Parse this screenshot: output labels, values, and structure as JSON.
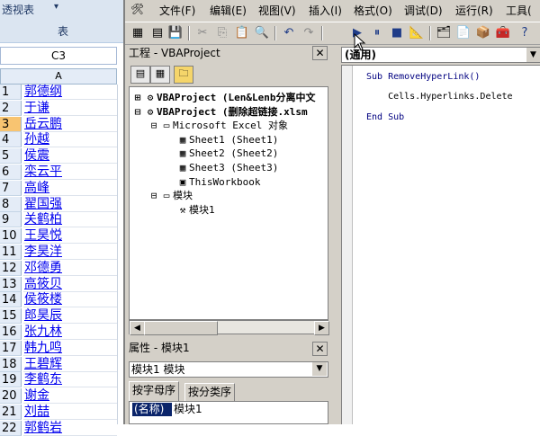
{
  "excel": {
    "ribbon_button": "透视表",
    "ribbon_button_arrow": "▾",
    "ribbon_group": "表",
    "name_box": "C3",
    "column_a": "A",
    "rows": [
      {
        "num": "1",
        "name": "郭德纲"
      },
      {
        "num": "2",
        "name": "于谦"
      },
      {
        "num": "3",
        "name": "岳云鹏"
      },
      {
        "num": "4",
        "name": "孙越"
      },
      {
        "num": "5",
        "name": "侯震"
      },
      {
        "num": "6",
        "name": "栾云平"
      },
      {
        "num": "7",
        "name": "高峰"
      },
      {
        "num": "8",
        "name": "翟国强"
      },
      {
        "num": "9",
        "name": "关鹤柏"
      },
      {
        "num": "10",
        "name": "王昊悦"
      },
      {
        "num": "11",
        "name": "李昊洋"
      },
      {
        "num": "12",
        "name": "邓德勇"
      },
      {
        "num": "13",
        "name": "高筱贝"
      },
      {
        "num": "14",
        "name": "侯筱楼"
      },
      {
        "num": "15",
        "name": "郎昊辰"
      },
      {
        "num": "16",
        "name": "张九林"
      },
      {
        "num": "17",
        "name": "韩九鸣"
      },
      {
        "num": "18",
        "name": "王碧辉"
      },
      {
        "num": "19",
        "name": "李鹤东"
      },
      {
        "num": "20",
        "name": "谢金"
      },
      {
        "num": "21",
        "name": "刘喆"
      },
      {
        "num": "22",
        "name": "郭鹤岩"
      }
    ],
    "selected_row": "3"
  },
  "vbe": {
    "menu": [
      "文件(F)",
      "编辑(E)",
      "视图(V)",
      "插入(I)",
      "格式(O)",
      "调试(D)",
      "运行(R)",
      "工具("
    ],
    "project_panel_title": "工程 - VBAProject",
    "close_symbol": "✕",
    "tree": [
      {
        "text": "VBAProject (Len&Lenb分离中文",
        "indent": 0,
        "toggle": "⊞",
        "icon": "⚙",
        "bold": true
      },
      {
        "text": "VBAProject (删除超链接.xlsm",
        "indent": 0,
        "toggle": "⊟",
        "icon": "⚙",
        "bold": true
      },
      {
        "text": "Microsoft Excel 对象",
        "indent": 1,
        "toggle": "⊟",
        "icon": "▭",
        "bold": false
      },
      {
        "text": "Sheet1 (Sheet1)",
        "indent": 2,
        "toggle": "",
        "icon": "▦",
        "bold": false
      },
      {
        "text": "Sheet2 (Sheet2)",
        "indent": 2,
        "toggle": "",
        "icon": "▦",
        "bold": false
      },
      {
        "text": "Sheet3 (Sheet3)",
        "indent": 2,
        "toggle": "",
        "icon": "▦",
        "bold": false
      },
      {
        "text": "ThisWorkbook",
        "indent": 2,
        "toggle": "",
        "icon": "▣",
        "bold": false
      },
      {
        "text": "模块",
        "indent": 1,
        "toggle": "⊟",
        "icon": "▭",
        "bold": false
      },
      {
        "text": "模块1",
        "indent": 2,
        "toggle": "",
        "icon": "⚒",
        "bold": false
      }
    ],
    "properties_title": "属性 - 模块1",
    "properties_select": "模块1 模块",
    "properties_tabs": [
      "按字母序",
      "按分类序"
    ],
    "property_key": "(名称)",
    "property_value": "模块1",
    "code_combo": "(通用)",
    "code_lines": [
      "Sub RemoveHyperLink()",
      "    Cells.Hyperlinks.Delete",
      "End Sub"
    ]
  }
}
